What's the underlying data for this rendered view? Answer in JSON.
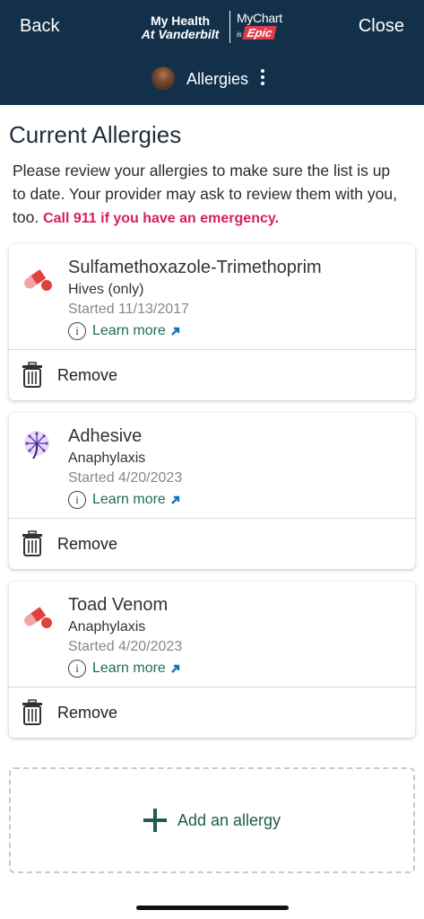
{
  "header": {
    "back_label": "Back",
    "close_label": "Close",
    "logo_line1": "My Health",
    "logo_line2": "At Vanderbilt",
    "mychart_label": "MyChart",
    "is_label": "is",
    "epic_label": "Epic",
    "section_title": "Allergies",
    "background_color": "#13304a"
  },
  "page": {
    "title": "Current Allergies",
    "intro_text": "Please review your allergies to make sure the list is up to date. Your provider may ask to review them with you, too.",
    "emergency_text": "Call 911 if you have an emergency.",
    "emergency_color": "#d61f5a"
  },
  "allergies": [
    {
      "icon": "medication-pill-icon",
      "name": "Sulfamethoxazole-Trimethoprim",
      "reaction": "Hives (only)",
      "started": "Started 11/13/2017",
      "learn_more": "Learn more",
      "remove_label": "Remove"
    },
    {
      "icon": "dandelion-icon",
      "name": "Adhesive",
      "reaction": "Anaphylaxis",
      "started": "Started 4/20/2023",
      "learn_more": "Learn more",
      "remove_label": "Remove"
    },
    {
      "icon": "medication-pill-icon",
      "name": "Toad Venom",
      "reaction": "Anaphylaxis",
      "started": "Started 4/20/2023",
      "learn_more": "Learn more",
      "remove_label": "Remove"
    }
  ],
  "add_allergy_label": "Add an allergy",
  "colors": {
    "link": "#1e6b5c",
    "add_accent": "#1e5c4f"
  }
}
